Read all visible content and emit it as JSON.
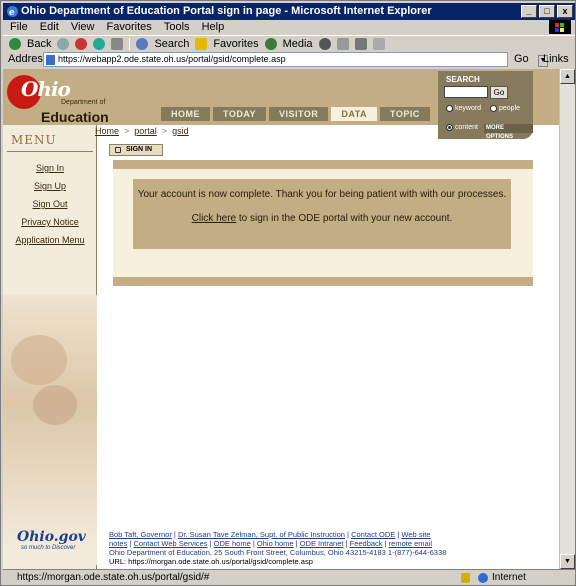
{
  "window": {
    "title": "Ohio Department of Education Portal sign in page - Microsoft Internet Explorer",
    "controls": [
      "_",
      "□",
      "x"
    ]
  },
  "menubar": [
    "File",
    "Edit",
    "View",
    "Favorites",
    "Tools",
    "Help"
  ],
  "toolbar": {
    "back": "Back",
    "search": "Search",
    "favorites": "Favorites",
    "media": "Media"
  },
  "address": {
    "label": "Address",
    "url": "https://webapp2.ode.state.oh.us/portal/gsid/complete.asp",
    "go": "Go",
    "links": "Links"
  },
  "logo": {
    "ohio": "Ohio",
    "dept": "Department of",
    "edu": "Education"
  },
  "tabs": [
    {
      "label": "HOME",
      "active": false
    },
    {
      "label": "TODAY",
      "active": false
    },
    {
      "label": "VISITOR",
      "active": false
    },
    {
      "label": "DATA",
      "active": true
    },
    {
      "label": "TOPIC",
      "active": false
    }
  ],
  "search": {
    "title": "SEARCH",
    "go": "Go",
    "options": [
      "keyword",
      "people",
      "content"
    ],
    "selected": "content",
    "more": "MORE OPTIONS"
  },
  "breadcrumb": [
    "Home",
    "portal",
    "gsid"
  ],
  "menu": {
    "heading": "MENU",
    "items": [
      "Sign In",
      "Sign Up",
      "Sign Out",
      "Privacy Notice",
      "Application Menu"
    ]
  },
  "signin_tab": "SIGN IN",
  "message": {
    "line1": "Your account is now complete.  Thank you for being patient with with our processes.",
    "link": "Click here",
    "line2": " to sign in the ODE portal with your new account."
  },
  "footer": {
    "links_line1": [
      "Bob Taft, Governor",
      "Dr. Susan Tave Zelman, Supt. of Public Instruction",
      "Contact ODE",
      "Web site"
    ],
    "links_line2": [
      "notes",
      "Contact Web Services",
      "ODE home",
      "Ohio home",
      "ODE Intranet",
      "Feedback",
      "remote email"
    ],
    "address": "Ohio Department of Education, 25 South Front Street, Columbus, Ohio 43215-4183 1-(877)-644-6338",
    "url_line": "URL: https://morgan.ode.state.oh.us/portal/gsid/complete.asp",
    "ohiogov": "Ohio.gov",
    "ohiogov_sub": "so much to Discover"
  },
  "status": {
    "url": "https://morgan.ode.state.oh.us/portal/gsid/#",
    "zone": "Internet"
  }
}
